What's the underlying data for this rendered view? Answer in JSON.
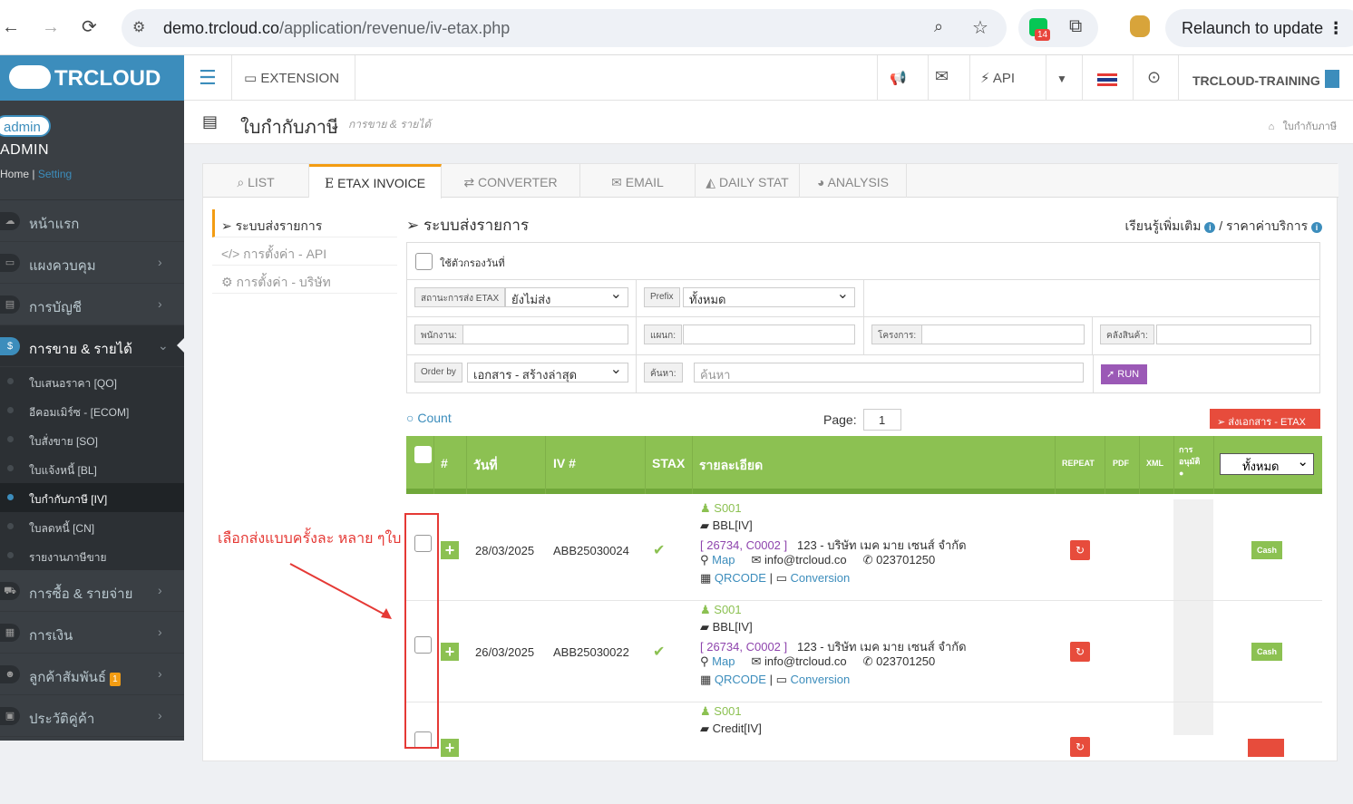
{
  "browser": {
    "url_host": "demo.trcloud.co",
    "url_path": "/application/revenue/iv-etax.php",
    "ext_badge": "14",
    "relaunch": "Relaunch to update"
  },
  "sidebar": {
    "logo": "TRCLOUD",
    "avatar_alt": "admin",
    "user_name": "ADMIN",
    "home": "Home",
    "setting": "Setting",
    "items": [
      {
        "label": "หน้าแรก",
        "icon": "cloud-icon"
      },
      {
        "label": "แผงควบคุม",
        "icon": "monitor-icon"
      },
      {
        "label": "การบัญชี",
        "icon": "book-icon"
      },
      {
        "label": "การขาย & รายได้",
        "icon": "dollar-icon"
      }
    ],
    "subitems": [
      "ใบเสนอราคา [QO]",
      "อีคอมเมิร์ซ - [ECOM]",
      "ใบสั่งขาย [SO]",
      "ใบแจ้งหนี้ [BL]",
      "ใบกำกับภาษี [IV]",
      "ใบลดหนี้ [CN]",
      "รายงานภาษีขาย"
    ],
    "items2": [
      {
        "label": "การซื้อ & รายจ่าย",
        "icon": "cart-icon"
      },
      {
        "label": "การเงิน",
        "icon": "calendar-icon"
      },
      {
        "label": "ลูกค้าสัมพันธ์",
        "icon": "users-icon",
        "badge": "1"
      },
      {
        "label": "ประวัติคู่ค้า",
        "icon": "contact-icon"
      }
    ]
  },
  "topbar": {
    "extension": "EXTENSION",
    "api": "API",
    "company": "TRCLOUD-TRAINING"
  },
  "header": {
    "title": "ใบกำกับภาษี",
    "subtitle": "การขาย & รายได้",
    "breadcrumb": "ใบกำกับภาษี"
  },
  "tabs": [
    "LIST",
    "ETAX INVOICE",
    "CONVERTER",
    "EMAIL",
    "DAILY STAT",
    "ANALYSIS"
  ],
  "leftmenu": [
    "ระบบส่งรายการ",
    "การตั้งค่า - API",
    "การตั้งค่า - บริษัท"
  ],
  "main": {
    "title": "ระบบส่งรายการ",
    "learn": "เรียนรู้เพิ่มเติม",
    "price": "ราคาค่าบริการ"
  },
  "filter": {
    "date_filter": "ใช้ตัวกรองวันที่",
    "status_label": "สถานะการส่ง ETAX",
    "status_value": "ยังไม่ส่ง",
    "prefix_label": "Prefix",
    "prefix_value": "ทั้งหมด",
    "employee_label": "พนักงาน:",
    "dept_label": "แผนก:",
    "project_label": "โครงการ:",
    "warehouse_label": "คลังสินค้า:",
    "order_label": "Order by",
    "order_value": "เอกสาร - สร้างล่าสุด",
    "search_label": "ค้นหา:",
    "search_placeholder": "ค้นหา",
    "run": "RUN"
  },
  "list": {
    "count": "Count",
    "page_label": "Page:",
    "page_value": "1",
    "send_btn": "ส่งเอกสาร - ETAX",
    "headers": {
      "num": "#",
      "date": "วันที่",
      "iv": "IV #",
      "stax": "STAX",
      "detail": "รายละเอียด",
      "repeat": "REPEAT",
      "pdf": "PDF",
      "xml": "XML",
      "approve": "การ อนุมัติ",
      "filter": "ทั้งหมด"
    }
  },
  "rows": [
    {
      "date": "28/03/2025",
      "iv": "ABB25030024",
      "code": "S001",
      "type": "BBL[IV]",
      "ref": "[ 26734, C0002 ]",
      "company": "123 - บริษัท เมค มาย เซนส์ จำกัด",
      "map": "Map",
      "email": "info@trcloud.co",
      "phone": "023701250",
      "qr": "QRCODE",
      "conv": "Conversion",
      "pay": "Cash"
    },
    {
      "date": "26/03/2025",
      "iv": "ABB25030022",
      "code": "S001",
      "type": "BBL[IV]",
      "ref": "[ 26734, C0002 ]",
      "company": "123 - บริษัท เมค มาย เซนส์ จำกัด",
      "map": "Map",
      "email": "info@trcloud.co",
      "phone": "023701250",
      "qr": "QRCODE",
      "conv": "Conversion",
      "pay": "Cash"
    },
    {
      "code": "S001",
      "type": "Credit[IV]"
    }
  ],
  "annotation": "เลือกส่งแบบครั้งละ หลาย ๆใบ",
  "colors": {
    "green": "#8cc152",
    "sidebar": "#3a3f44",
    "brand": "#3c8dbc",
    "accent": "#f39c12",
    "red": "#e74c3c"
  }
}
